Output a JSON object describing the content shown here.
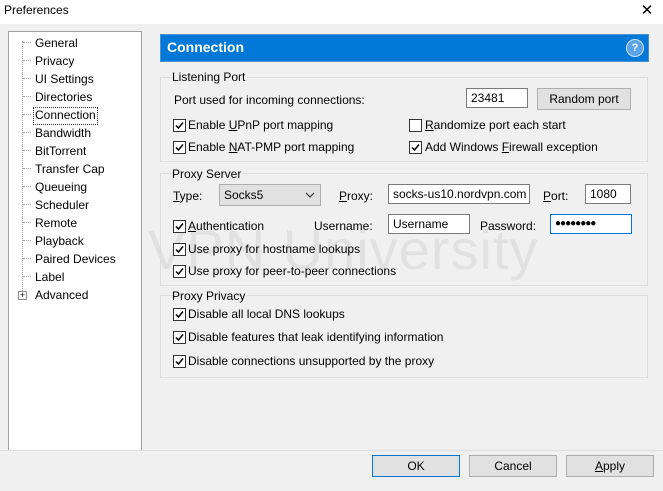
{
  "window": {
    "title": "Preferences"
  },
  "tree": {
    "items": [
      {
        "label": "General"
      },
      {
        "label": "Privacy"
      },
      {
        "label": "UI Settings"
      },
      {
        "label": "Directories"
      },
      {
        "label": "Connection"
      },
      {
        "label": "Bandwidth"
      },
      {
        "label": "BitTorrent"
      },
      {
        "label": "Transfer Cap"
      },
      {
        "label": "Queueing"
      },
      {
        "label": "Scheduler"
      },
      {
        "label": "Remote"
      },
      {
        "label": "Playback"
      },
      {
        "label": "Paired Devices"
      },
      {
        "label": "Label"
      },
      {
        "label": "Advanced"
      }
    ],
    "selected": "Connection"
  },
  "header": {
    "title": "Connection",
    "help": "?"
  },
  "listening_port": {
    "title": "Listening Port",
    "port_label": "Port used for incoming connections:",
    "port_value": "23481",
    "random_button": "Random port",
    "upnp": {
      "label_pre": "Enable ",
      "label_u": "U",
      "label_post": "PnP port mapping",
      "checked": true
    },
    "natpmp": {
      "label_pre": "Enable ",
      "label_u": "N",
      "label_post": "AT-PMP port mapping",
      "checked": true
    },
    "randomize": {
      "label_pre": "",
      "label_u": "R",
      "label_post": "andomize port each start",
      "checked": false
    },
    "firewall": {
      "label_pre": "Add Windows ",
      "label_u": "F",
      "label_post": "irewall exception",
      "checked": true
    }
  },
  "proxy_server": {
    "title": "Proxy Server",
    "type_label_u": "T",
    "type_label_post": "ype:",
    "type_value": "Socks5",
    "proxy_label_u": "P",
    "proxy_label_post": "roxy:",
    "proxy_value": "socks-us10.nordvpn.com",
    "port_label_u": "P",
    "port_label_post": "ort:",
    "port_value": "1080",
    "auth": {
      "label_pre": "",
      "label_u": "A",
      "label_post": "uthentication",
      "checked": true
    },
    "username_label": "Username:",
    "username_value": "Username",
    "password_label": "Password:",
    "password_value": "●●●●●●●●",
    "hostname": {
      "label": "Use proxy for hostname lookups",
      "checked": true
    },
    "p2p": {
      "label": "Use proxy for peer-to-peer connections",
      "checked": true
    }
  },
  "proxy_privacy": {
    "title": "Proxy Privacy",
    "dns": {
      "label": "Disable all local DNS lookups",
      "checked": true
    },
    "leak": {
      "label": "Disable features that leak identifying information",
      "checked": true
    },
    "unsupported": {
      "label": "Disable connections unsupported by the proxy",
      "checked": true
    }
  },
  "watermark": "VPN University",
  "buttons": {
    "ok": "OK",
    "cancel": "Cancel",
    "apply_u": "A",
    "apply_post": "pply"
  },
  "colors": {
    "accent": "#0078d7",
    "header_bg": "#0078d7",
    "window_bg": "#f0f0f0"
  }
}
